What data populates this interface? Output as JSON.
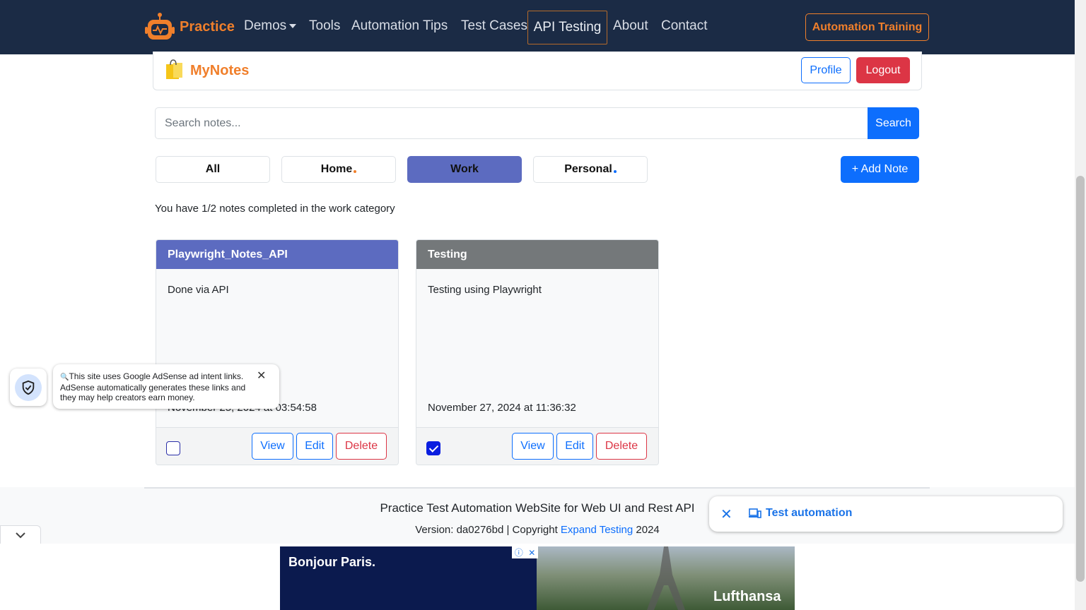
{
  "nav": {
    "brand": "Practice",
    "links": [
      "Demos",
      "Tools",
      "Automation Tips",
      "Test Cases",
      "API Testing",
      "About",
      "Contact"
    ],
    "training": "Automation Training"
  },
  "notes_header": {
    "title": "MyNotes",
    "profile": "Profile",
    "logout": "Logout"
  },
  "search": {
    "placeholder": "Search notes...",
    "button": "Search"
  },
  "categories": [
    {
      "label": "All",
      "dot_color": ""
    },
    {
      "label": "Home",
      "dot_color": "#f07f2b"
    },
    {
      "label": "Work",
      "dot_color": ""
    },
    {
      "label": "Personal",
      "dot_color": "#0d6efd"
    }
  ],
  "active_category": "Work",
  "add_note": "+ Add Note",
  "progress_text": "You have 1/2 notes completed in the work category",
  "notes": [
    {
      "title": "Playwright_Notes_API",
      "description": "Done via API",
      "date": "November 25, 2024 at 03:54:58",
      "completed": false,
      "header_color": "#5c6bc0"
    },
    {
      "title": "Testing",
      "description": "Testing using Playwright",
      "date": "November 27, 2024 at 11:36:32",
      "completed": true,
      "header_color": "#74787a"
    }
  ],
  "card_buttons": {
    "view": "View",
    "edit": "Edit",
    "delete": "Delete"
  },
  "adsense_tip": "This site uses Google AdSense ad intent links. AdSense automatically generates these links and they may help creators earn money.",
  "footer": {
    "title": "Practice Test Automation WebSite for Web UI and Rest API",
    "version_prefix": "Version: da0276bd | Copyright ",
    "link": "Expand Testing",
    "year": " 2024"
  },
  "search_chip": "Test automation",
  "ad": {
    "headline": "Bonjour Paris.",
    "brand": "Lufthansa"
  }
}
